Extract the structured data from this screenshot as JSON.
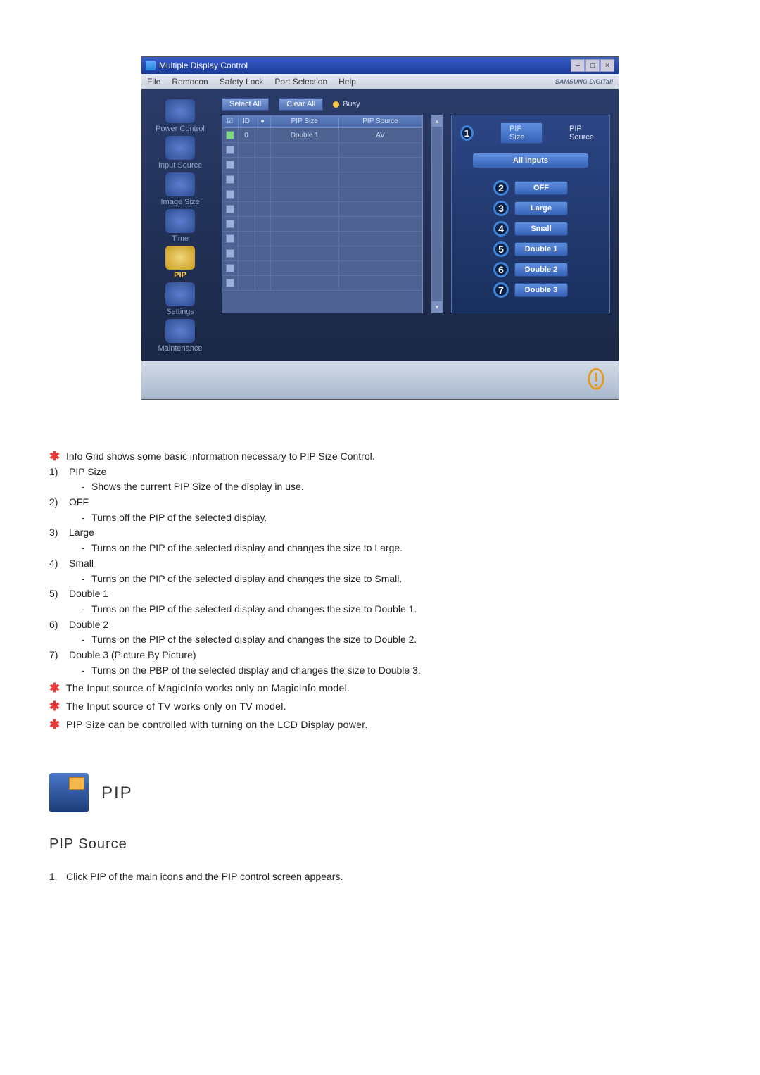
{
  "window": {
    "title": "Multiple Display Control",
    "menubar": [
      "File",
      "Remocon",
      "Safety Lock",
      "Port Selection",
      "Help"
    ],
    "brand": "SAMSUNG DIGITall"
  },
  "sidebar": [
    {
      "label": "Power Control"
    },
    {
      "label": "Input Source"
    },
    {
      "label": "Image Size"
    },
    {
      "label": "Time"
    },
    {
      "label": "PIP"
    },
    {
      "label": "Settings"
    },
    {
      "label": "Maintenance"
    }
  ],
  "toolbar": {
    "select_all": "Select All",
    "clear_all": "Clear All",
    "busy": "Busy"
  },
  "grid": {
    "headers": {
      "chk": "☑",
      "id": "ID",
      "status": "●",
      "pipsize": "PIP Size",
      "pipsource": "PIP Source"
    },
    "row0": {
      "id": "0",
      "pipsize": "Double 1",
      "pipsource": "AV"
    }
  },
  "panel": {
    "pipsize_label": "PIP Size",
    "pipsource_label": "PIP Source",
    "all_inputs": "All Inputs",
    "options": [
      {
        "num": "2",
        "label": "OFF"
      },
      {
        "num": "3",
        "label": "Large"
      },
      {
        "num": "4",
        "label": "Small"
      },
      {
        "num": "5",
        "label": "Double 1"
      },
      {
        "num": "6",
        "label": "Double 2"
      },
      {
        "num": "7",
        "label": "Double 3"
      }
    ],
    "marker_1": "1"
  },
  "doc": {
    "star1": "Info Grid shows some basic information necessary to PIP Size Control.",
    "items": [
      {
        "n": "1)",
        "title": "PIP Size",
        "sub": "Shows the current PIP Size of the display in use."
      },
      {
        "n": "2)",
        "title": "OFF",
        "sub": "Turns off the PIP of the selected display."
      },
      {
        "n": "3)",
        "title": "Large",
        "sub": "Turns on the PIP of the selected display and changes the size to Large."
      },
      {
        "n": "4)",
        "title": "Small",
        "sub": "Turns on the PIP of the selected display and changes the size to Small."
      },
      {
        "n": "5)",
        "title": "Double 1",
        "sub": "Turns on the PIP of the selected display and changes the size to Double 1."
      },
      {
        "n": "6)",
        "title": "Double 2",
        "sub": "Turns on the PIP of the selected display and changes the size to Double 2."
      },
      {
        "n": "7)",
        "title": "Double 3 (Picture By Picture)",
        "sub": "Turns on the PBP of the selected display and changes the size to Double 3."
      }
    ],
    "note1": "The Input source of MagicInfo works only on MagicInfo model.",
    "note2": "The Input source of TV works only on TV model.",
    "note3": "PIP Size can be controlled with turning on the LCD Display power."
  },
  "section": {
    "pip_title": "PIP",
    "sub_title": "PIP Source",
    "step1_num": "1.",
    "step1_text": "Click PIP of the main icons and the PIP control screen appears."
  }
}
